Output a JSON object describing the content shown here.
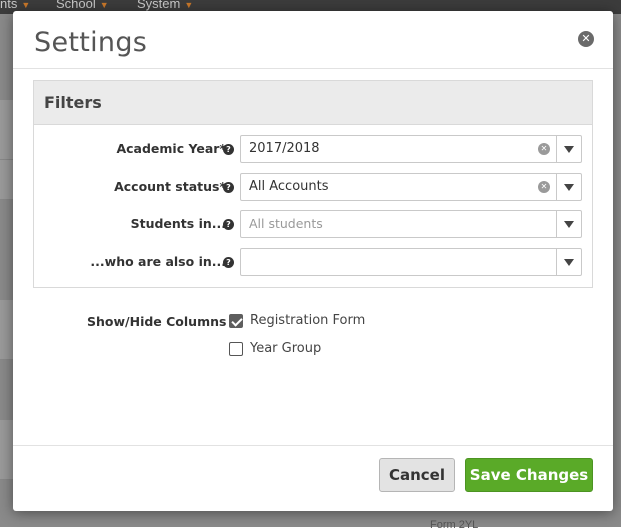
{
  "background": {
    "nav_items": [
      "nts",
      "School",
      "System"
    ],
    "footer_text": "Form 2YL"
  },
  "modal": {
    "title": "Settings",
    "close_icon": "close-icon",
    "filters": {
      "heading": "Filters",
      "rows": [
        {
          "label": "Academic Year*",
          "value": "2017/2018",
          "placeholder": "",
          "clearable": true
        },
        {
          "label": "Account status*",
          "value": "All Accounts",
          "placeholder": "",
          "clearable": true
        },
        {
          "label": "Students in...",
          "value": "",
          "placeholder": "All students",
          "clearable": false
        },
        {
          "label": "...who are also in...",
          "value": "",
          "placeholder": "",
          "clearable": false
        }
      ]
    },
    "columns": {
      "label": "Show/Hide Columns",
      "options": [
        {
          "label": "Registration Form",
          "checked": true
        },
        {
          "label": "Year Group",
          "checked": false
        }
      ]
    },
    "footer": {
      "cancel_label": "Cancel",
      "save_label": "Save Changes"
    }
  },
  "colors": {
    "save_button": "#5aaa28",
    "cancel_button": "#e3e3e3",
    "nav_caret": "#c9782a"
  }
}
